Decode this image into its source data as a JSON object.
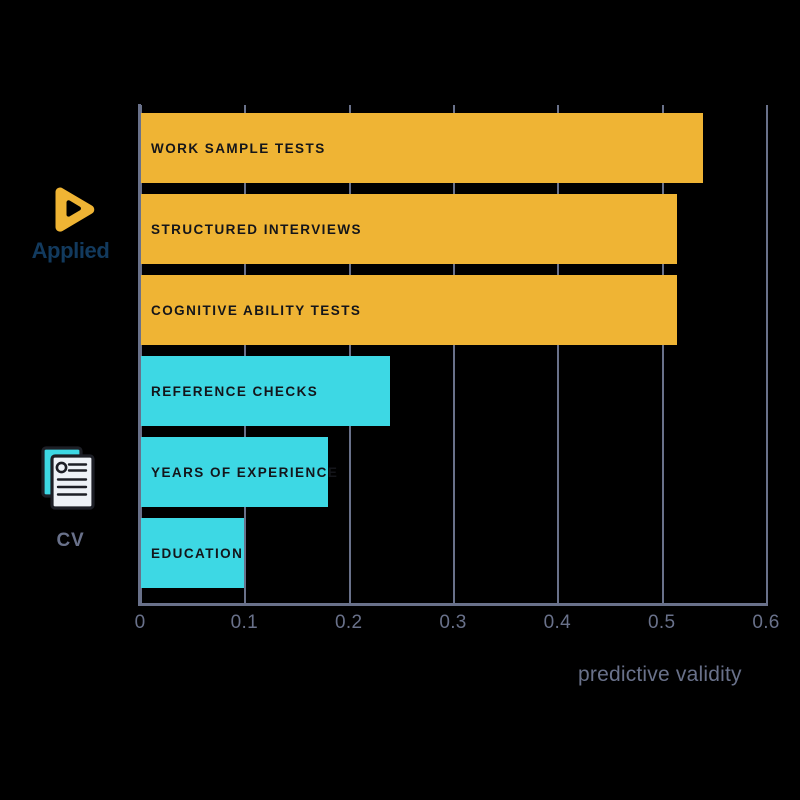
{
  "chart_data": {
    "type": "bar",
    "orientation": "horizontal",
    "title": "",
    "xlabel": "predictive validity",
    "ylabel": "",
    "xlim": [
      0,
      0.6
    ],
    "xticks": [
      "0",
      "0.1",
      "0.2",
      "0.3",
      "0.4",
      "0.5",
      "0.6"
    ],
    "xtick_values": [
      0,
      0.1,
      0.2,
      0.3,
      0.4,
      0.5,
      0.6
    ],
    "grid": true,
    "grid_axis": "x",
    "legend_position": "left-outside",
    "categories": [
      "WORK SAMPLE TESTS",
      "STRUCTURED INTERVIEWS",
      "COGNITIVE ABILITY TESTS",
      "REFERENCE CHECKS",
      "YEARS OF EXPERIENCE",
      "EDUCATION"
    ],
    "values": [
      0.54,
      0.515,
      0.515,
      0.24,
      0.18,
      0.1
    ],
    "bars": [
      {
        "label": "WORK SAMPLE TESTS",
        "value": 0.54,
        "group": "Applied",
        "color": "#EFB434"
      },
      {
        "label": "STRUCTURED INTERVIEWS",
        "value": 0.515,
        "group": "Applied",
        "color": "#EFB434"
      },
      {
        "label": "COGNITIVE ABILITY TESTS",
        "value": 0.515,
        "group": "Applied",
        "color": "#EFB434"
      },
      {
        "label": "REFERENCE CHECKS",
        "value": 0.24,
        "group": "CV",
        "color": "#3DD8E4"
      },
      {
        "label": "YEARS OF EXPERIENCE",
        "value": 0.18,
        "group": "CV",
        "color": "#3DD8E4"
      },
      {
        "label": "EDUCATION",
        "value": 0.1,
        "group": "CV",
        "color": "#3DD8E4"
      }
    ],
    "groups": [
      {
        "name": "Applied",
        "color": "#EFB434"
      },
      {
        "name": "CV",
        "color": "#3DD8E4"
      }
    ]
  },
  "legend": {
    "applied": {
      "label": "Applied",
      "icon": "applied-play-logo",
      "mark_color": "#EFB434",
      "text_color": "#123A5E"
    },
    "cv": {
      "label": "CV",
      "icon": "cv-documents-icon",
      "mark_color": "#3DD8E4",
      "text_color": "#69718A"
    }
  },
  "axis": {
    "title": "predictive validity",
    "line_color": "#69718A",
    "tick_color": "#69718A"
  },
  "colors": {
    "background": "#000000",
    "applied_bar": "#EFB434",
    "cv_bar": "#3DD8E4",
    "axis": "#69718A",
    "bar_label": "#14151A",
    "applied_text": "#123A5E"
  }
}
